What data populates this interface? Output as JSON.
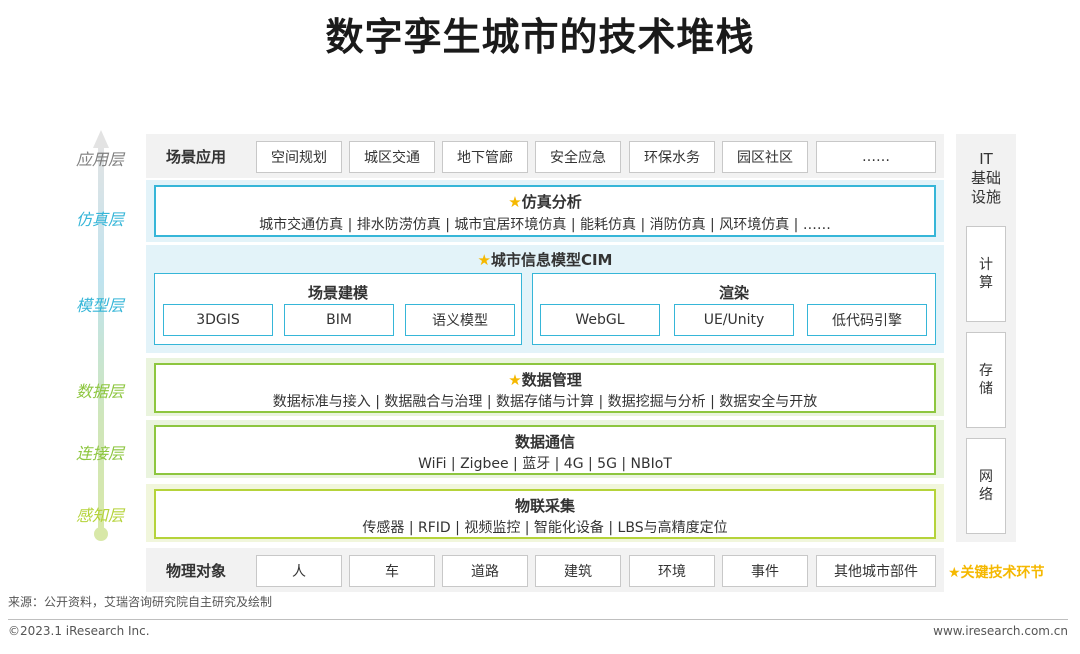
{
  "title": "数字孪生城市的技术堆栈",
  "layers": [
    {
      "label": "应用层",
      "color": "#7f7f7f"
    },
    {
      "label": "仿真层",
      "color": "#36b6d8"
    },
    {
      "label": "模型层",
      "color": "#36b6d8"
    },
    {
      "label": "数据层",
      "color": "#8dc63f"
    },
    {
      "label": "连接层",
      "color": "#8dc63f"
    },
    {
      "label": "感知层",
      "color": "#b5d33a"
    }
  ],
  "application": {
    "header": "场景应用",
    "items": [
      "空间规划",
      "城区交通",
      "地下管廊",
      "安全应急",
      "环保水务",
      "园区社区",
      "……"
    ]
  },
  "simulation": {
    "star": "★",
    "title": "仿真分析",
    "subtitle": "城市交通仿真 | 排水防涝仿真 | 城市宜居环境仿真 | 能耗仿真 | 消防仿真 | 风环境仿真 | ……"
  },
  "model": {
    "star": "★",
    "title": "城市信息模型CIM",
    "scene": {
      "title": "场景建模",
      "items": [
        "3DGIS",
        "BIM",
        "语义模型"
      ]
    },
    "render": {
      "title": "渲染",
      "items": [
        "WebGL",
        "UE/Unity",
        "低代码引擎"
      ]
    }
  },
  "data_mgmt": {
    "star": "★",
    "title": "数据管理",
    "subtitle": "数据标准与接入 | 数据融合与治理 | 数据存储与计算 | 数据挖掘与分析 | 数据安全与开放"
  },
  "comm": {
    "title": "数据通信",
    "subtitle": "WiFi | Zigbee | 蓝牙 | 4G | 5G | NBIoT"
  },
  "iot": {
    "title": "物联采集",
    "subtitle": "传感器 | RFID | 视频监控 | 智能化设备 | LBS与高精度定位"
  },
  "physical": {
    "header": "物理对象",
    "items": [
      "人",
      "车",
      "道路",
      "建筑",
      "环境",
      "事件",
      "其他城市部件"
    ]
  },
  "it_infra": {
    "header": "IT\n基础\n设施",
    "items": [
      "计\n算",
      "存\n储",
      "网\n络"
    ]
  },
  "legend": "★关键技术环节",
  "source": "来源：公开资料，艾瑞咨询研究院自主研究及绘制",
  "copyright": "©2023.1 iResearch Inc.",
  "website": "www.iresearch.com.cn",
  "colors": {
    "blue": "#36b6d8",
    "green": "#8dc63f",
    "lime": "#b5d33a",
    "star": "#f5b800"
  }
}
